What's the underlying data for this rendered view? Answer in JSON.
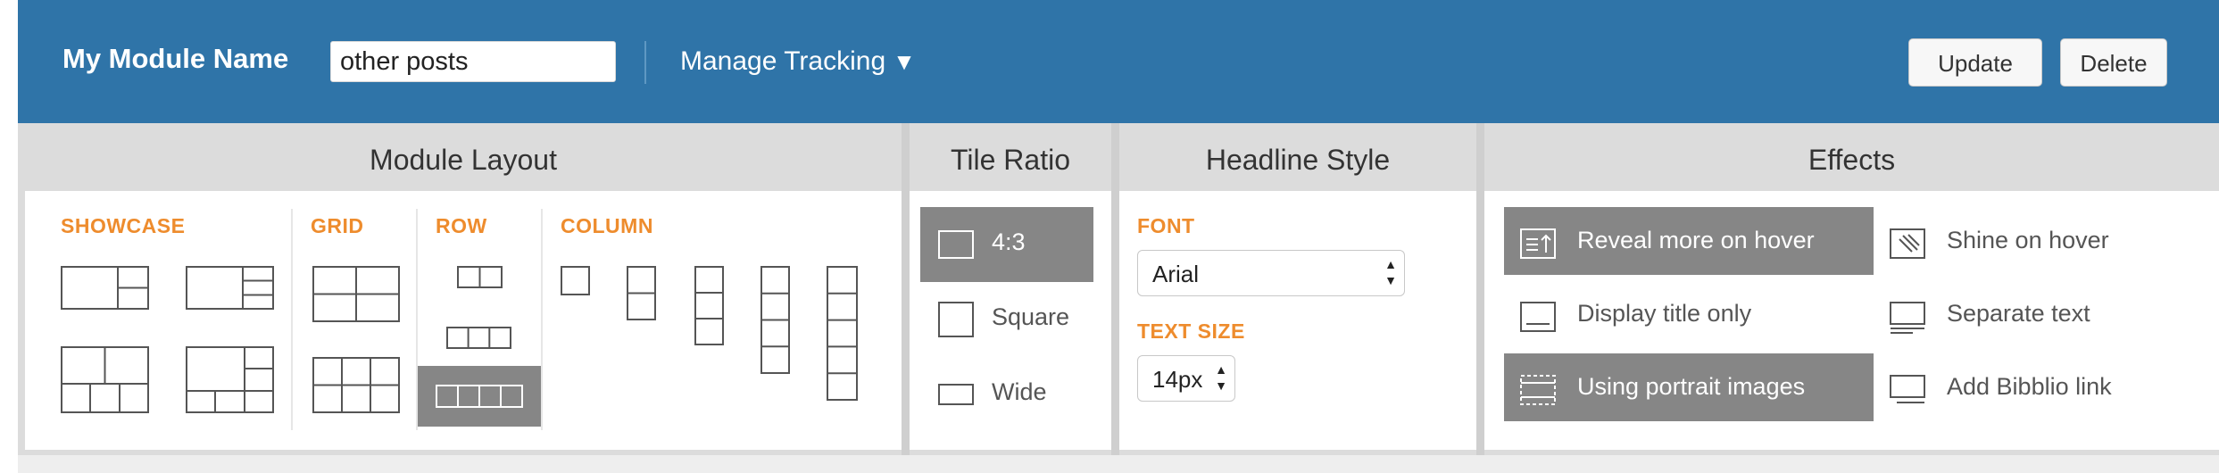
{
  "header": {
    "module_name_label": "My Module Name",
    "module_name_value": "other posts",
    "manage_tracking_label": "Manage Tracking",
    "manage_tracking_caret": "▼",
    "update_label": "Update",
    "delete_label": "Delete"
  },
  "panels": {
    "module_layout": {
      "title": "Module Layout",
      "sections": [
        {
          "label": "SHOWCASE"
        },
        {
          "label": "GRID"
        },
        {
          "label": "ROW"
        },
        {
          "label": "COLUMN"
        }
      ],
      "selected_option": "row-4"
    },
    "tile_ratio": {
      "title": "Tile Ratio",
      "options": [
        {
          "label": "4:3",
          "selected": true
        },
        {
          "label": "Square",
          "selected": false
        },
        {
          "label": "Wide",
          "selected": false
        }
      ]
    },
    "headline_style": {
      "title": "Headline Style",
      "font_label": "FONT",
      "font_value": "Arial",
      "text_size_label": "TEXT SIZE",
      "text_size_value": "14px"
    },
    "effects": {
      "title": "Effects",
      "options": [
        {
          "label": "Reveal more on hover",
          "selected": true,
          "icon": "reveal-more-icon"
        },
        {
          "label": "Shine on hover",
          "selected": false,
          "icon": "shine-icon"
        },
        {
          "label": "Display title only",
          "selected": false,
          "icon": "title-only-icon"
        },
        {
          "label": "Separate text",
          "selected": false,
          "icon": "separate-text-icon"
        },
        {
          "label": "Using portrait images",
          "selected": true,
          "icon": "portrait-images-icon"
        },
        {
          "label": "Add Bibblio link",
          "selected": false,
          "icon": "bibblio-link-icon"
        }
      ]
    }
  },
  "colors": {
    "header_bg": "#2f74a8",
    "accent_orange": "#ee8c2d",
    "selected_bg": "#868686",
    "panel_bg": "#dcdcdc"
  }
}
